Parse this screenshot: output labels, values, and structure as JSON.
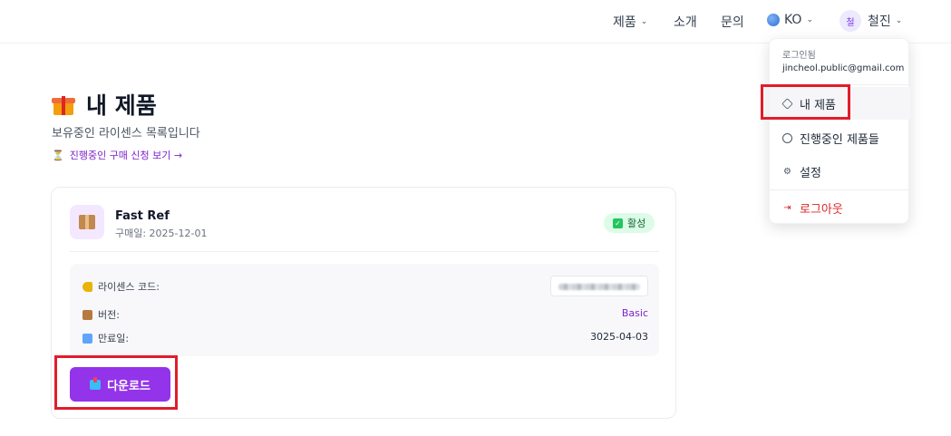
{
  "nav": {
    "products": "제품",
    "about": "소개",
    "contact": "문의",
    "language": "KO",
    "avatar_initial": "철",
    "username": "철진"
  },
  "page": {
    "title": "내 제품",
    "subtitle": "보유중인 라이센스 목록입니다",
    "pending_link": "진행중인 구매 신청 보기 →"
  },
  "product": {
    "name": "Fast Ref",
    "purchase_date": "구매일: 2025-12-01",
    "status": "활성",
    "license_label": "라이센스 코드:",
    "version_label": "버전:",
    "version_value": "Basic",
    "expiry_label": "만료일:",
    "expiry_value": "3025-04-03",
    "download_label": "다운로드"
  },
  "menu": {
    "logged_in_label": "로그인됨",
    "email": "jincheol.public@gmail.com",
    "items": [
      {
        "label": "내 제품",
        "icon": "cube-icon"
      },
      {
        "label": "진행중인 제품들",
        "icon": "clock-icon"
      },
      {
        "label": "설정",
        "icon": "gear-icon"
      },
      {
        "label": "로그아웃",
        "icon": "logout-icon"
      }
    ]
  },
  "colors": {
    "accent": "#9333ea",
    "link": "#7e22ce",
    "status_bg": "#dcfce7",
    "highlight": "#e11d2b",
    "logout": "#dc2626"
  }
}
